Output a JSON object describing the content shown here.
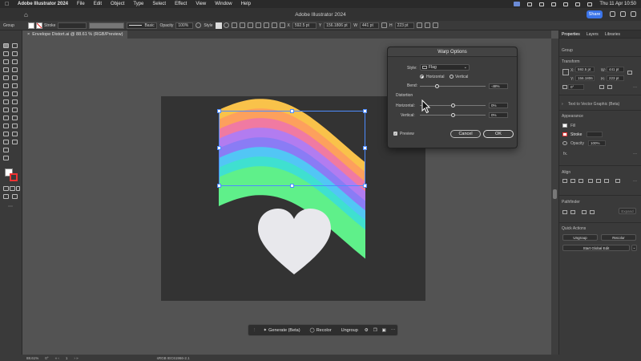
{
  "menubar": {
    "app_name": "Adobe Illustrator 2024",
    "items": [
      "File",
      "Edit",
      "Object",
      "Type",
      "Select",
      "Effect",
      "View",
      "Window",
      "Help"
    ],
    "clock": "Thu 11 Apr 10:50"
  },
  "titlebar": {
    "title": "Adobe Illustrator 2024",
    "share_label": "Share"
  },
  "controlbar": {
    "selection_label": "Group",
    "stroke_label": "Stroke",
    "brush_label": "Basic",
    "opacity_label": "Opacity",
    "opacity_value": "100%",
    "style_label": "Style",
    "x_label": "X",
    "x_value": "592.5 pt",
    "y_label": "Y",
    "y_value": "156.1806 pt",
    "w_label": "W",
    "w_value": "441 pt",
    "h_label": "H",
    "h_value": "223 pt"
  },
  "doc_tab": {
    "label": "Envelope Distort.ai @ 88.61 % (RGB/Preview)"
  },
  "right_panel": {
    "tabs": [
      "Properties",
      "Layers",
      "Libraries"
    ],
    "selection_type": "Group",
    "transform_label": "Transform",
    "x_value": "592.5 pt",
    "y_value": "156.1806",
    "w_value": "441 pt",
    "h_value": "223 pt",
    "angle_value": "0°",
    "text_to_vector": "Text to Vector Graphic (Beta)",
    "appearance_label": "Appearance",
    "fill_label": "Fill",
    "stroke_label": "Stroke",
    "opacity_label": "Opacity",
    "opacity_value": "100%",
    "fx_label": "fx.",
    "align_label": "Align",
    "pathfinder_label": "Pathfinder",
    "expand_label": "Expand",
    "quick_actions_label": "Quick Actions",
    "ungroup_label": "Ungroup",
    "recolor_label": "Recolor",
    "global_edit_label": "Start Global Edit"
  },
  "dialog": {
    "title": "Warp Options",
    "style_label": "Style:",
    "style_value": "Flag",
    "horizontal_label": "Horizontal",
    "vertical_label": "Vertical",
    "orientation": "horizontal",
    "bend_label": "Bend:",
    "bend_value": "-48%",
    "bend_fraction": 0.26,
    "distortion_label": "Distortion",
    "dist_h_label": "Horizontal:",
    "dist_h_value": "0%",
    "dist_h_fraction": 0.5,
    "dist_v_label": "Vertical:",
    "dist_v_value": "0%",
    "dist_v_fraction": 0.5,
    "preview_label": "Preview",
    "preview_checked": true,
    "cancel_label": "Cancel",
    "ok_label": "OK"
  },
  "context_bar": {
    "generate_label": "Generate (Beta)",
    "recolor_label": "Recolor",
    "ungroup_label": "Ungroup"
  },
  "statusbar": {
    "zoom": "88.61%",
    "angle": "0°",
    "page": "1",
    "color_mode": "sRGB IEC61966-2.1"
  },
  "colors": {
    "accent": "#3b74e8",
    "selection": "#4d8cff",
    "wave": [
      "#f9c24a",
      "#fda05d",
      "#f07aa2",
      "#b27cf0",
      "#8a7cf5",
      "#52c6f5",
      "#3fe0d0",
      "#5ff08a"
    ],
    "heart": "#e8e8ec"
  }
}
